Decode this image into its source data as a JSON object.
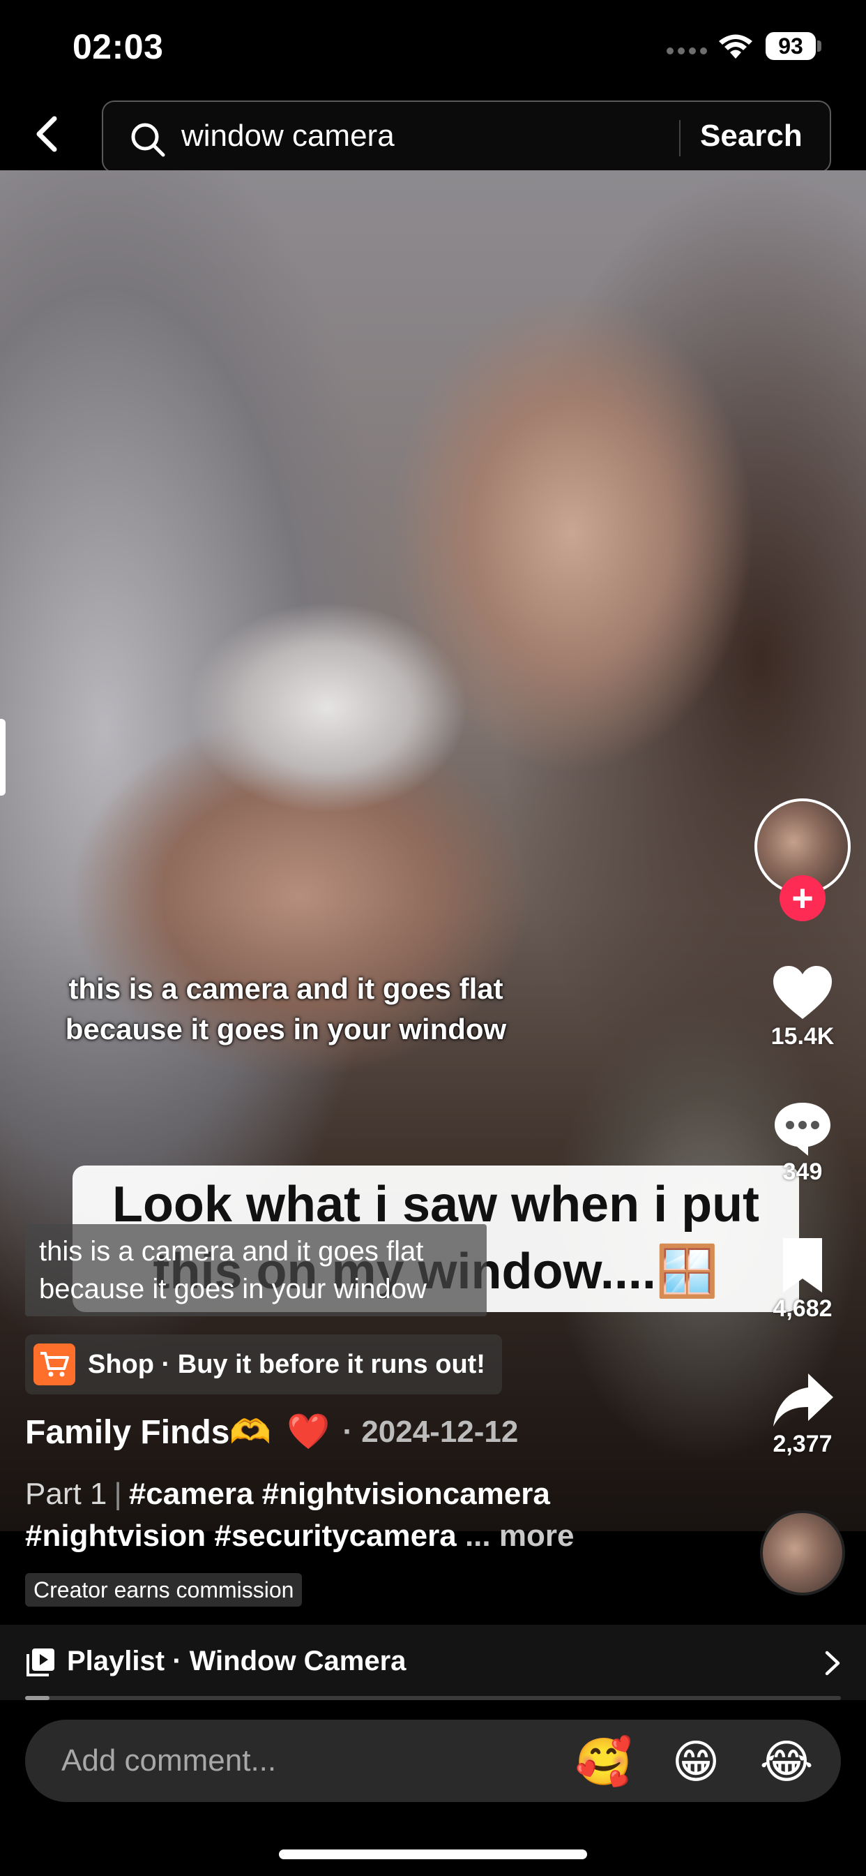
{
  "status_bar": {
    "time": "02:03",
    "battery": "93"
  },
  "search": {
    "query": "window camera",
    "search_label": "Search"
  },
  "video": {
    "overlay_caption": "this is a camera and it goes flat because it goes in your window",
    "title_text": "Look what i saw when i put this on my window....🪟",
    "closed_caption": "this is a camera and it goes flat because it goes in your window"
  },
  "actions": {
    "follow_symbol": "+",
    "likes": "15.4K",
    "comments": "349",
    "bookmarks": "4,682",
    "shares": "2,377"
  },
  "shop": {
    "text": "Shop · Buy it before it runs out!"
  },
  "post": {
    "author": "Family Finds🫶",
    "author_emoji": "❤️",
    "date": "· 2024-12-12",
    "part": "Part 1",
    "separator": "|",
    "hashtags_line1": "#camera #nightvisioncamera",
    "hashtags_line2": "#nightvision #securitycamera",
    "more": "... more",
    "commission": "Creator earns commission"
  },
  "playlist": {
    "label": "Playlist · Window Camera",
    "progress": 0.03
  },
  "comment": {
    "placeholder": "Add comment...",
    "emojis": [
      "🥰",
      "😁",
      "😂"
    ]
  },
  "colors": {
    "accent": "#fe2c55",
    "shop": "#ff6f2c",
    "background": "#000000"
  }
}
